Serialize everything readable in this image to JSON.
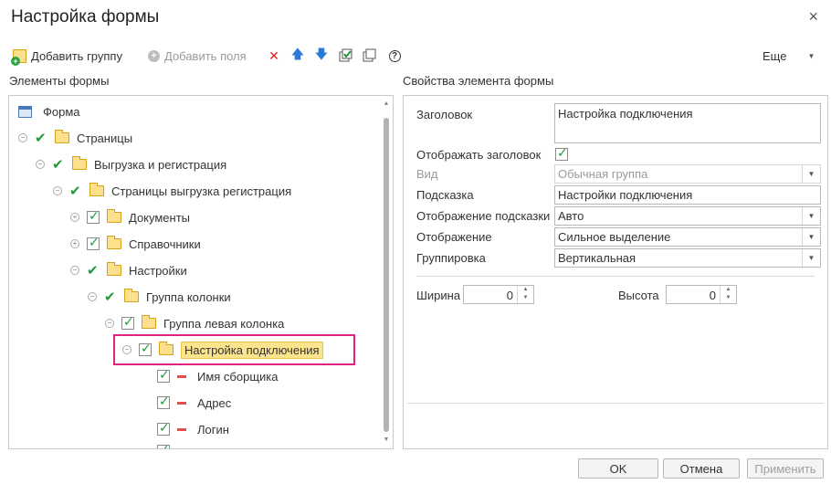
{
  "window": {
    "title": "Настройка формы",
    "close_glyph": "×"
  },
  "toolbar": {
    "add_group": "Добавить группу",
    "add_fields": "Добавить поля",
    "more": "Еще"
  },
  "sections": {
    "elements": "Элементы формы",
    "properties": "Свойства элемента формы"
  },
  "tree": {
    "items": [
      {
        "label": "Форма"
      },
      {
        "label": "Страницы"
      },
      {
        "label": "Выгрузка и регистрация"
      },
      {
        "label": "Страницы выгрузка регистрация"
      },
      {
        "label": "Документы"
      },
      {
        "label": "Справочники"
      },
      {
        "label": "Настройки"
      },
      {
        "label": "Группа колонки"
      },
      {
        "label": "Группа левая колонка"
      },
      {
        "label": "Настройка подключения"
      },
      {
        "label": "Имя сборщика"
      },
      {
        "label": "Адрес"
      },
      {
        "label": "Логин"
      }
    ]
  },
  "properties": {
    "header_label": "Заголовок",
    "header_value": "Настройка подключения",
    "show_header_label": "Отображать заголовок",
    "kind_label": "Вид",
    "kind_value": "Обычная группа",
    "hint_label": "Подсказка",
    "hint_value": "Настройки подключения",
    "hint_display_label": "Отображение подсказки",
    "hint_display_value": "Авто",
    "display_label": "Отображение",
    "display_value": "Сильное выделение",
    "grouping_label": "Группировка",
    "grouping_value": "Вертикальная",
    "width_label": "Ширина",
    "width_value": "0",
    "height_label": "Высота",
    "height_value": "0"
  },
  "buttons": {
    "ok": "OK",
    "cancel": "Отмена",
    "apply": "Применить"
  }
}
